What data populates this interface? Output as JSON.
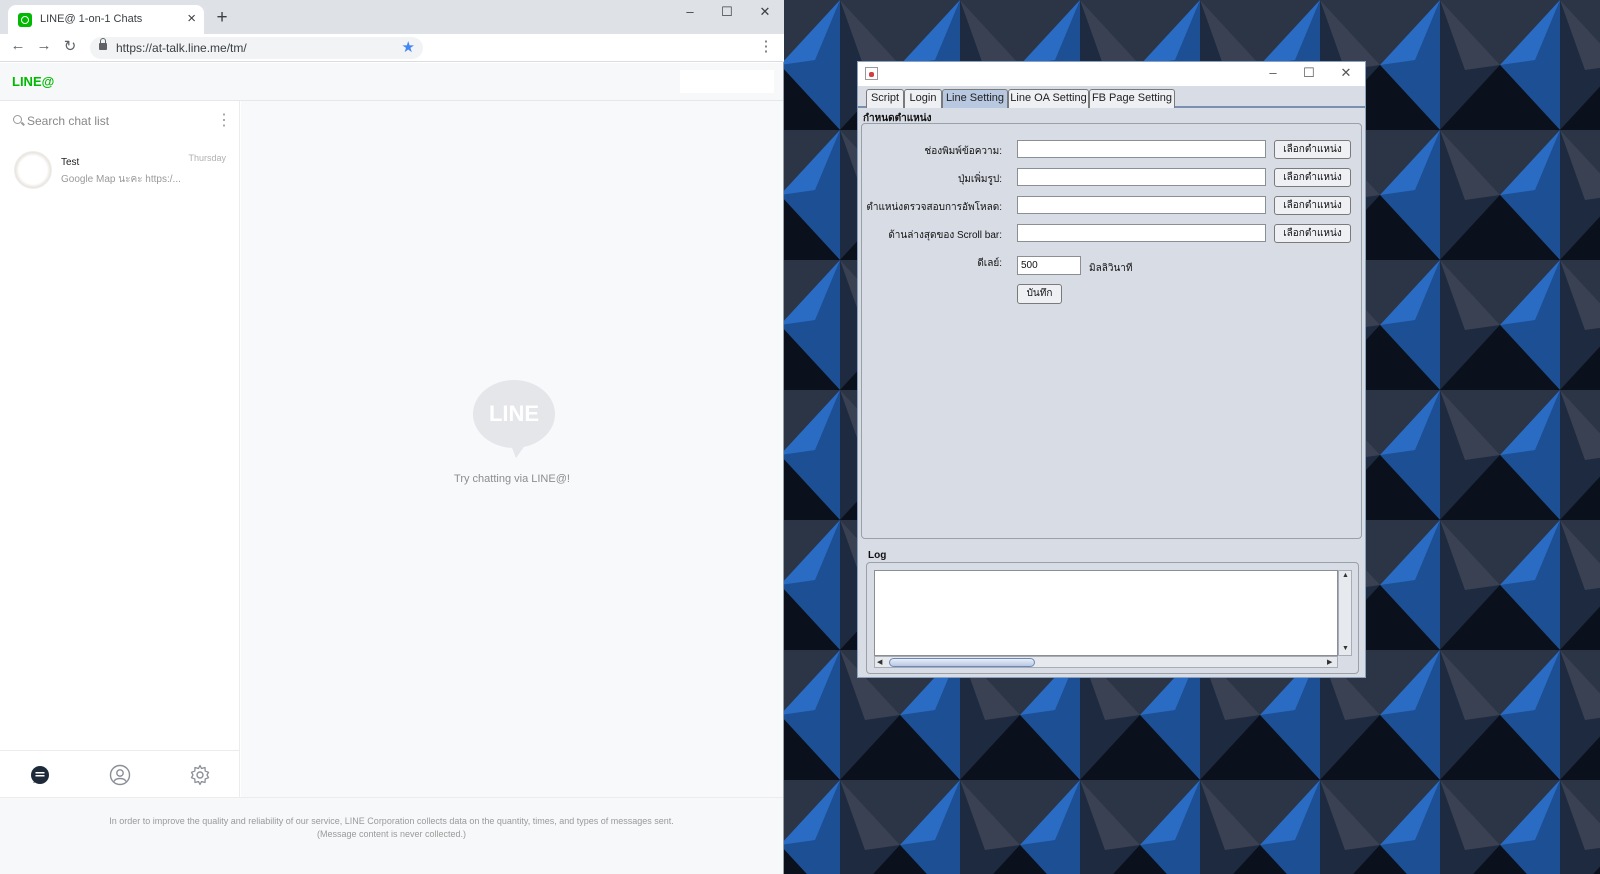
{
  "browser": {
    "tab_title": "LINE@ 1-on-1 Chats",
    "url": "https://at-talk.line.me/tm/"
  },
  "line": {
    "logo": "LINE@",
    "search_placeholder": "Search chat list",
    "chats": [
      {
        "name": "Test",
        "time": "Thursday",
        "preview": "Google Map นะคะ https:/..."
      }
    ],
    "empty_logo_text": "LINE",
    "empty_text": "Try chatting via LINE@!",
    "footer_line1": "In order to improve the quality and reliability of our service, LINE Corporation collects data on the quantity, times, and types of messages sent.",
    "footer_line2": "(Message content is never collected.)",
    "colors": {
      "brand": "#00b900"
    }
  },
  "app": {
    "tabs": [
      {
        "label": "Script",
        "active": false
      },
      {
        "label": "Login",
        "active": false
      },
      {
        "label": "Line Setting",
        "active": true
      },
      {
        "label": "Line OA Setting",
        "active": false
      },
      {
        "label": "FB Page Setting",
        "active": false
      }
    ],
    "section_title": "กำหนดตำแหน่ง",
    "fields": [
      {
        "label": "ช่องพิมพ์ข้อความ:",
        "value": "",
        "button": "เลือกตำแหน่ง"
      },
      {
        "label": "ปุ่มเพิ่มรูป:",
        "value": "",
        "button": "เลือกตำแหน่ง"
      },
      {
        "label": "ตำแหน่งตรวจสอบการอัพโหลด:",
        "value": "",
        "button": "เลือกตำแหน่ง"
      },
      {
        "label": "ด้านล่างสุดของ Scroll bar:",
        "value": "",
        "button": "เลือกตำแหน่ง"
      }
    ],
    "delay_label": "ดีเลย์:",
    "delay_value": "500",
    "delay_unit": "มิลลิวินาที",
    "save_label": "บันทึก",
    "log_title": "Log"
  }
}
